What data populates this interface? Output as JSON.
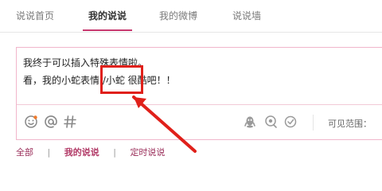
{
  "tabs": [
    {
      "label": "说说首页",
      "active": false
    },
    {
      "label": "我的说说",
      "active": true
    },
    {
      "label": "我的微博",
      "active": false
    },
    {
      "label": "说说墙",
      "active": false
    }
  ],
  "composer": {
    "line1": "我终于可以插入特殊表情啦。",
    "line2": "看，我的小蛇表情 /小蛇 很酷吧！！"
  },
  "toolbar": {
    "visibility_label": "可见范围："
  },
  "filters": {
    "all": "全部",
    "mine": "我的说说",
    "scheduled": "定时说说",
    "separator": "|"
  },
  "colors": {
    "accent": "#c7386f",
    "highlight": "#e0201a"
  }
}
